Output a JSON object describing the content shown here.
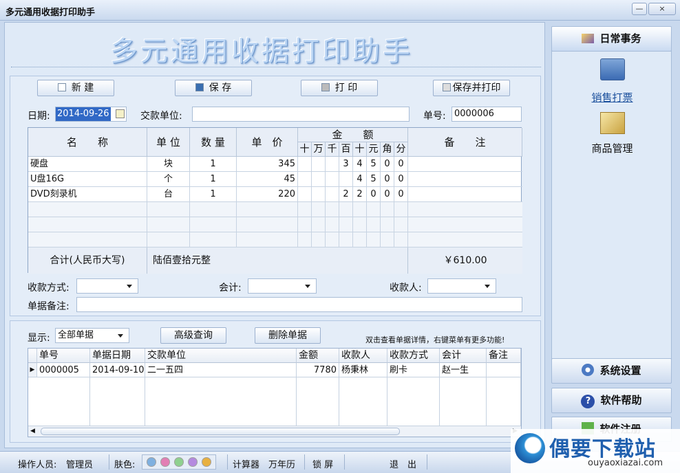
{
  "window": {
    "title": "多元通用收据打印助手",
    "minimize": "—",
    "close": "×"
  },
  "banner": "多元通用收据打印助手",
  "toolbar": {
    "new": "新  建",
    "save": "保  存",
    "print": "打  印",
    "save_print": "保存并打印"
  },
  "form": {
    "date_label": "日期:",
    "date_value": "2014-09-26",
    "payer_label": "交款单位:",
    "payer_value": "",
    "number_label": "单号:",
    "number_value": "0000006"
  },
  "receipt": {
    "headers": {
      "name": "名　　称",
      "unit": "单 位",
      "qty": "数 量",
      "price": "单　价",
      "amount": "金　　额",
      "note": "备　　注",
      "digits": [
        "十",
        "万",
        "千",
        "百",
        "十",
        "元",
        "角",
        "分"
      ]
    },
    "rows": [
      {
        "name": "硬盘",
        "unit": "块",
        "qty": "1",
        "price": "345",
        "digits": [
          "",
          "",
          "",
          "3",
          "4",
          "5",
          "0",
          "0"
        ]
      },
      {
        "name": "U盘16G",
        "unit": "个",
        "qty": "1",
        "price": "45",
        "digits": [
          "",
          "",
          "",
          "",
          "4",
          "5",
          "0",
          "0"
        ]
      },
      {
        "name": "DVD刻录机",
        "unit": "台",
        "qty": "1",
        "price": "220",
        "digits": [
          "",
          "",
          "",
          "2",
          "2",
          "0",
          "0",
          "0"
        ]
      }
    ],
    "total_label": "合计(人民币大写)",
    "total_words": "陆佰壹拾元整",
    "total_value": "￥610.00"
  },
  "payment": {
    "method_label": "收款方式:",
    "accountant_label": "会计:",
    "receiver_label": "收款人:",
    "remark_label": "单据备注:"
  },
  "list": {
    "show_label": "显示:",
    "show_value": "全部单据",
    "advanced_query": "高级查询",
    "delete": "删除单据",
    "hint": "双击查看单据详情，右键菜单有更多功能!",
    "columns": [
      "单号",
      "单据日期",
      "交款单位",
      "金额",
      "收款人",
      "收款方式",
      "会计",
      "备注"
    ],
    "rows": [
      [
        "0000005",
        "2014-09-10",
        "二一五四",
        "7780",
        "杨秉林",
        "刷卡",
        "赵一生",
        ""
      ]
    ]
  },
  "sidebar": {
    "daily": "日常事务",
    "sales": "销售打票",
    "products": "商品管理",
    "settings": "系统设置",
    "help": "软件帮助",
    "register": "软件注册"
  },
  "status": {
    "operator_label": "操作人员:",
    "operator": "管理员",
    "skin_label": "肤色:",
    "calculator": "计算器",
    "calendar": "万年历",
    "lock": "锁 屏",
    "exit": "退　出"
  },
  "skins": [
    "#7fb0e0",
    "#e27fb4",
    "#8fd08f",
    "#b48adf",
    "#e8b040"
  ],
  "watermark": {
    "brand": "偶要下载站",
    "url": "ouyaoxiazai.com"
  }
}
